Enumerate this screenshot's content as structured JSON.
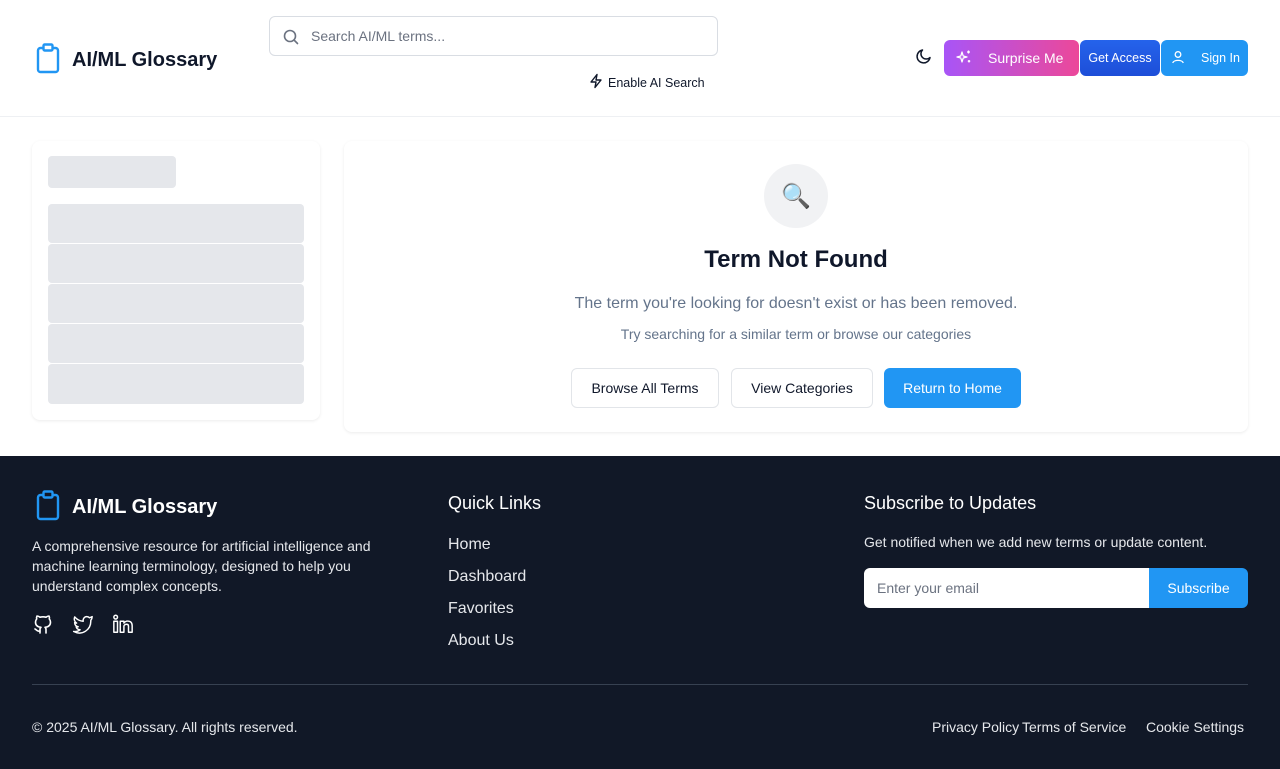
{
  "header": {
    "brand": "AI/ML Glossary",
    "search_placeholder": "Search AI/ML terms...",
    "ai_search_label": "Enable AI Search",
    "surprise_label": "Surprise Me",
    "access_label": "Get Access",
    "signin_label": "Sign In"
  },
  "main": {
    "emoji": "🔍",
    "title": "Term Not Found",
    "subtitle": "The term you're looking for doesn't exist or has been removed.",
    "hint": "Try searching for a similar term or browse our categories",
    "buttons": {
      "browse": "Browse All Terms",
      "categories": "View Categories",
      "home": "Return to Home"
    }
  },
  "footer": {
    "brand": "AI/ML Glossary",
    "description": "A comprehensive resource for artificial intelligence and machine learning terminology, designed to help you understand complex concepts.",
    "quick_links_title": "Quick Links",
    "quick_links": [
      "Home",
      "Dashboard",
      "Favorites",
      "About Us"
    ],
    "subscribe_title": "Subscribe to Updates",
    "subscribe_desc": "Get notified when we add new terms or update content.",
    "email_placeholder": "Enter your email",
    "subscribe_label": "Subscribe",
    "copyright": "© 2025 AI/ML Glossary. All rights reserved.",
    "legal": {
      "privacy": "Privacy Policy",
      "terms": "Terms of Service",
      "cookies": "Cookie Settings"
    }
  },
  "colors": {
    "accent": "#2196f3",
    "footer_bg": "#111827",
    "surprise_gradient": [
      "#a855f7",
      "#ec4899"
    ]
  },
  "icons": {
    "brand": "clipboard-icon",
    "search": "search-icon",
    "ai_search": "lightning-icon",
    "theme": "moon-icon",
    "surprise": "sparkles-icon",
    "signin": "user-icon",
    "socials": [
      "github-icon",
      "twitter-icon",
      "linkedin-icon"
    ]
  }
}
